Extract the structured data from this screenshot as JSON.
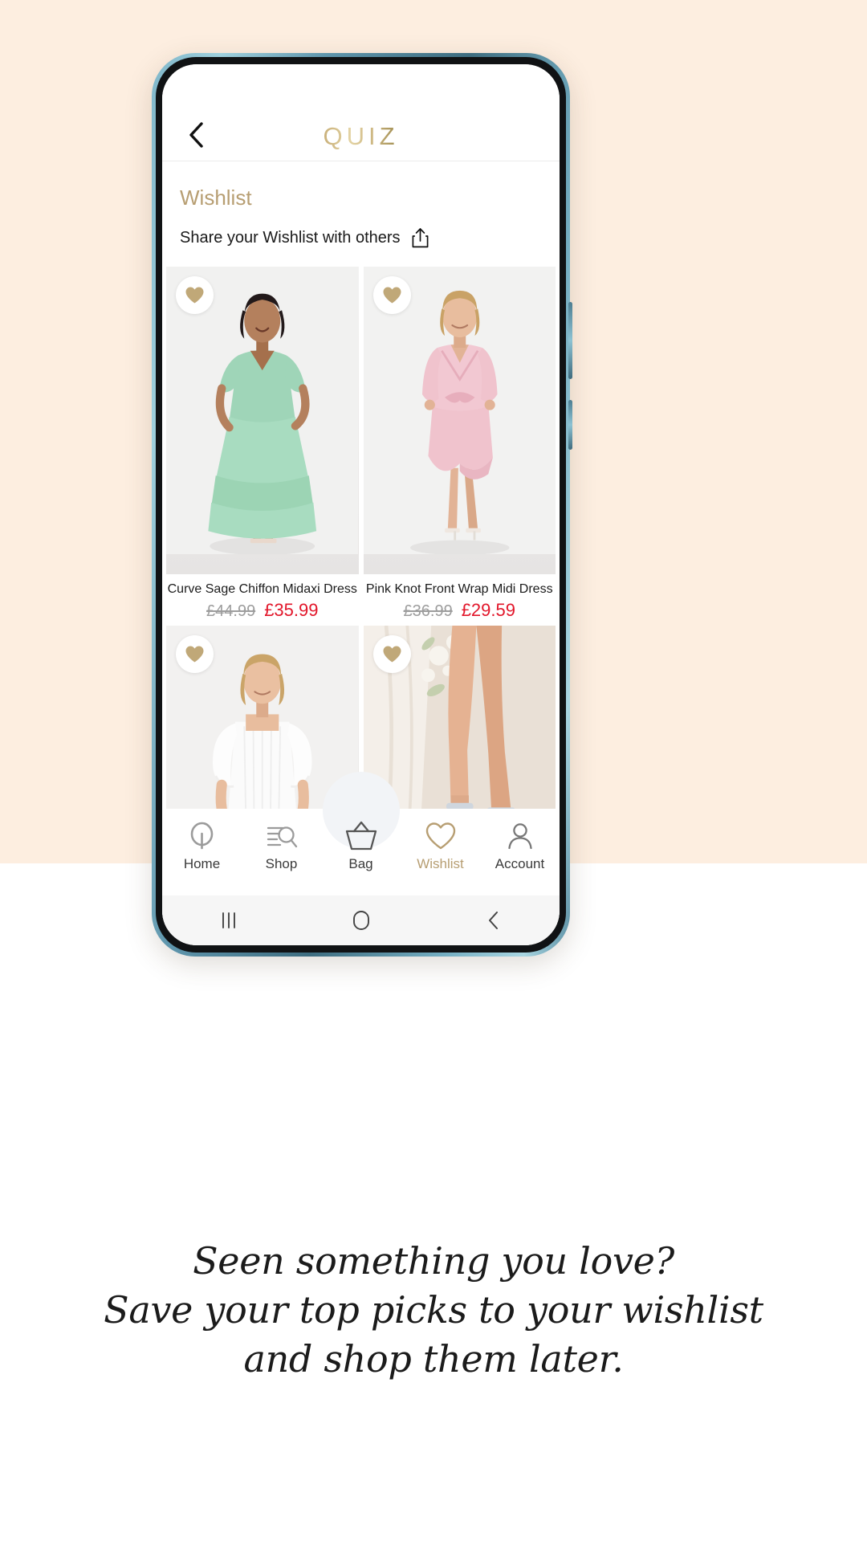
{
  "app": {
    "brand": "QUIZ",
    "back_icon": "chevron-left-icon"
  },
  "page": {
    "title": "Wishlist",
    "share_label": "Share your Wishlist with others",
    "share_icon": "share-icon"
  },
  "products": [
    {
      "name": "Curve Sage Chiffon Midaxi Dress",
      "price_was": "£44.99",
      "price_now": "£35.99",
      "favourite_icon": "heart-filled-icon",
      "colour": "#a8dcc0"
    },
    {
      "name": "Pink Knot Front Wrap Midi Dress",
      "price_was": "£36.99",
      "price_now": "£29.59",
      "favourite_icon": "heart-filled-icon",
      "colour": "#f0c3cd"
    },
    {
      "name": "",
      "price_was": "",
      "price_now": "",
      "favourite_icon": "heart-filled-icon",
      "colour": "#ffffff"
    },
    {
      "name": "",
      "price_was": "",
      "price_now": "",
      "favourite_icon": "heart-filled-icon",
      "colour": "#d9c6b4"
    }
  ],
  "bottom_nav": {
    "items": [
      {
        "label": "Home",
        "icon": "quiz-q-logo-icon",
        "active": false
      },
      {
        "label": "Shop",
        "icon": "list-search-icon",
        "active": false
      },
      {
        "label": "Bag",
        "icon": "basket-icon",
        "active": false
      },
      {
        "label": "Wishlist",
        "icon": "heart-outline-icon",
        "active": true
      },
      {
        "label": "Account",
        "icon": "person-icon",
        "active": false
      }
    ]
  },
  "android_nav": {
    "recents_icon": "recents-icon",
    "home_icon": "home-pill-icon",
    "back_icon": "back-chevron-icon"
  },
  "caption": {
    "line1": "Seen something you love?",
    "line2": "Save your top picks to your wishlist",
    "line3": "and shop them later."
  },
  "colors": {
    "brand_gold": "#b79e72",
    "sale_red": "#e2162a",
    "background_top": "#fdeee0",
    "background_bottom": "#ffffff"
  }
}
